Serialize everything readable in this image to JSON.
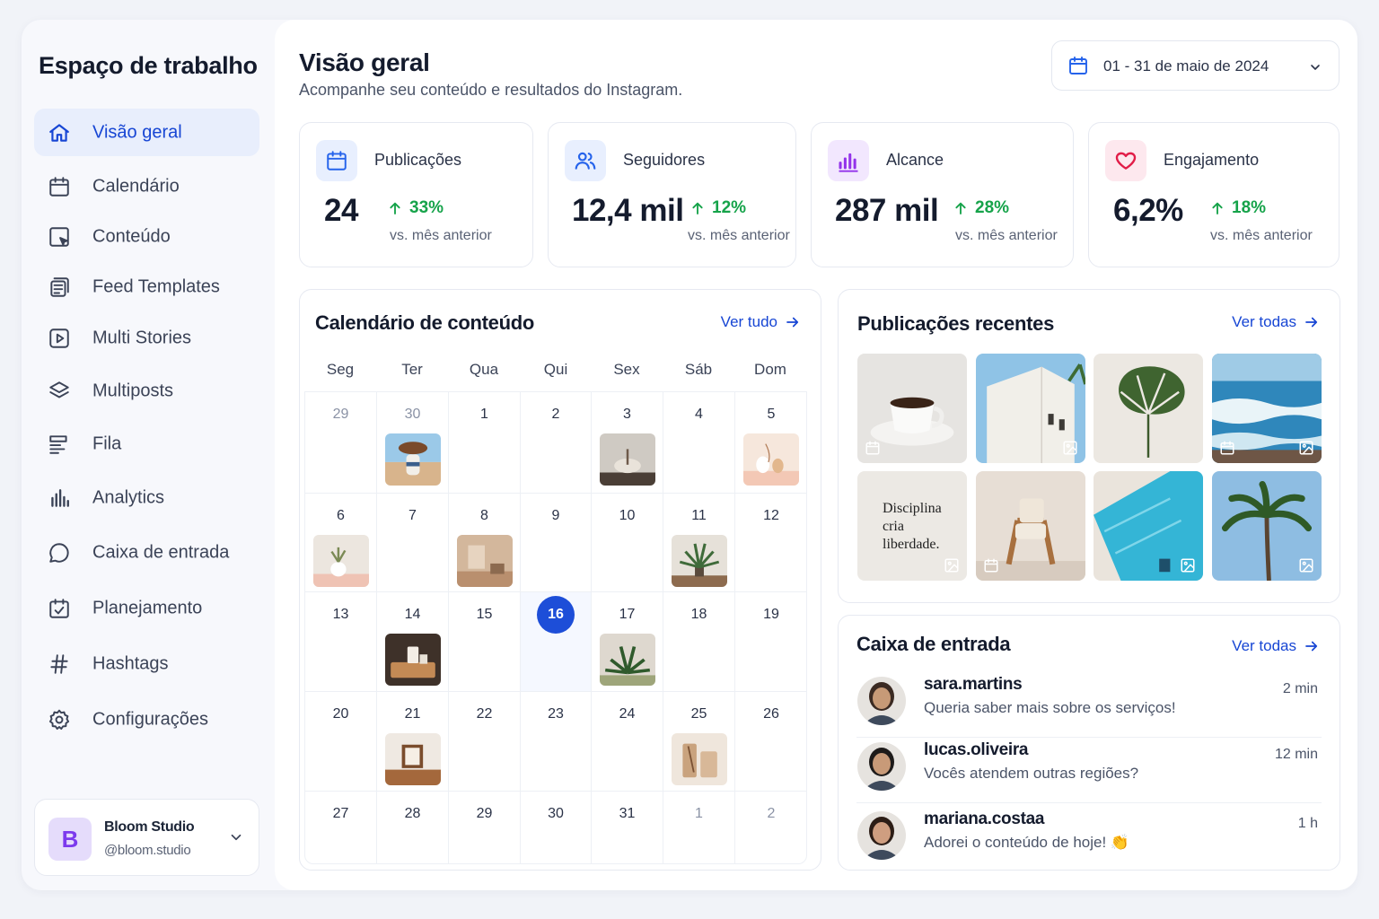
{
  "sidebar": {
    "title": "Espaço de trabalho",
    "items": [
      {
        "label": "Visão geral",
        "icon": "home-icon"
      },
      {
        "label": "Calendário",
        "icon": "calendar-icon"
      },
      {
        "label": "Conteúdo",
        "icon": "content-icon"
      },
      {
        "label": "Feed Templates",
        "icon": "feed-templates-icon"
      },
      {
        "label": "Multi Stories",
        "icon": "play-icon"
      },
      {
        "label": "Multiposts",
        "icon": "layers-icon"
      },
      {
        "label": "Fila",
        "icon": "queue-icon"
      },
      {
        "label": "Analytics",
        "icon": "bar-chart-icon"
      },
      {
        "label": "Caixa de entrada",
        "icon": "chat-bubble-icon"
      },
      {
        "label": "Planejamento",
        "icon": "calendar-check-icon"
      },
      {
        "label": "Hashtags",
        "icon": "hashtag-icon"
      },
      {
        "label": "Configurações",
        "icon": "gear-icon"
      }
    ],
    "profile": {
      "initial": "B",
      "name": "Bloom Studio",
      "handle": "@bloom.studio"
    }
  },
  "header": {
    "title": "Visão geral",
    "subtitle": "Acompanhe seu conteúdo e resultados do Instagram.",
    "date_range": "01 - 31 de maio de 2024"
  },
  "stats": [
    {
      "label": "Publicações",
      "value": "24",
      "delta": "33%",
      "compare": "vs. mês anterior",
      "icon": "calendar-icon",
      "color": "#2563eb"
    },
    {
      "label": "Seguidores",
      "value": "12,4 mil",
      "delta": "12%",
      "compare": "vs. mês anterior",
      "icon": "users-icon",
      "color": "#2563eb"
    },
    {
      "label": "Alcance",
      "value": "287 mil",
      "delta": "28%",
      "compare": "vs. mês anterior",
      "icon": "reach-bars-icon",
      "color": "#9333ea"
    },
    {
      "label": "Engajamento",
      "value": "6,2%",
      "delta": "18%",
      "compare": "vs. mês anterior",
      "icon": "heart-icon",
      "color": "#e11d48"
    }
  ],
  "calendar": {
    "title": "Calendário de conteúdo",
    "link": "Ver tudo",
    "weekdays": [
      "Seg",
      "Ter",
      "Qua",
      "Qui",
      "Sex",
      "Sáb",
      "Dom"
    ],
    "weeks": [
      [
        {
          "d": "29",
          "m": true
        },
        {
          "d": "30",
          "m": true,
          "img": "beach-figure"
        },
        {
          "d": "1"
        },
        {
          "d": "2"
        },
        {
          "d": "3",
          "img": "vase-table"
        },
        {
          "d": "4"
        },
        {
          "d": "5",
          "img": "vases-peach"
        }
      ],
      [
        {
          "d": "6",
          "img": "plant-pot"
        },
        {
          "d": "7"
        },
        {
          "d": "8",
          "img": "interior-room"
        },
        {
          "d": "9"
        },
        {
          "d": "10"
        },
        {
          "d": "11",
          "img": "palm-pot"
        },
        {
          "d": "12"
        }
      ],
      [
        {
          "d": "13"
        },
        {
          "d": "14",
          "img": "candle-tray"
        },
        {
          "d": "15"
        },
        {
          "d": "16",
          "today": true
        },
        {
          "d": "17",
          "img": "palm-garden"
        },
        {
          "d": "18"
        },
        {
          "d": "19"
        }
      ],
      [
        {
          "d": "20"
        },
        {
          "d": "21",
          "img": "frame-shelf"
        },
        {
          "d": "22"
        },
        {
          "d": "23"
        },
        {
          "d": "24"
        },
        {
          "d": "25",
          "img": "decor-objects"
        },
        {
          "d": "26"
        }
      ],
      [
        {
          "d": "27"
        },
        {
          "d": "28"
        },
        {
          "d": "29"
        },
        {
          "d": "30"
        },
        {
          "d": "31"
        },
        {
          "d": "1",
          "m": true
        },
        {
          "d": "2",
          "m": true
        }
      ]
    ]
  },
  "recent": {
    "title": "Publicações recentes",
    "link": "Ver todas",
    "posts": [
      {
        "kind": "coffee-cup",
        "badges": [
          "calendar-icon"
        ]
      },
      {
        "kind": "white-building",
        "badges": [
          "image-icon"
        ]
      },
      {
        "kind": "monstera-leaf",
        "badges": []
      },
      {
        "kind": "ocean-waves",
        "badges": [
          "calendar-icon",
          "image-icon"
        ]
      },
      {
        "kind": "quote-card",
        "quote": [
          "Disciplina",
          "cria",
          "liberdade."
        ],
        "badges": [
          "image-icon"
        ]
      },
      {
        "kind": "wooden-chair",
        "badges": [
          "calendar-icon"
        ]
      },
      {
        "kind": "pool",
        "badges": [
          "image-icon"
        ]
      },
      {
        "kind": "palm-tree",
        "badges": [
          "image-icon"
        ]
      }
    ]
  },
  "inbox": {
    "title": "Caixa de entrada",
    "link": "Ver todas",
    "messages": [
      {
        "user": "sara.martins",
        "text": "Queria saber mais sobre os serviços!",
        "time": "2 min"
      },
      {
        "user": "lucas.oliveira",
        "text": "Vocês atendem outras regiões?",
        "time": "12 min"
      },
      {
        "user": "mariana.costaa",
        "text": "Adorei o conteúdo de hoje! 👏",
        "time": "1 h"
      }
    ]
  },
  "colors": {
    "accent": "#1d4ed8",
    "positive": "#16a34a",
    "active_nav_bg": "#e8eefc"
  }
}
